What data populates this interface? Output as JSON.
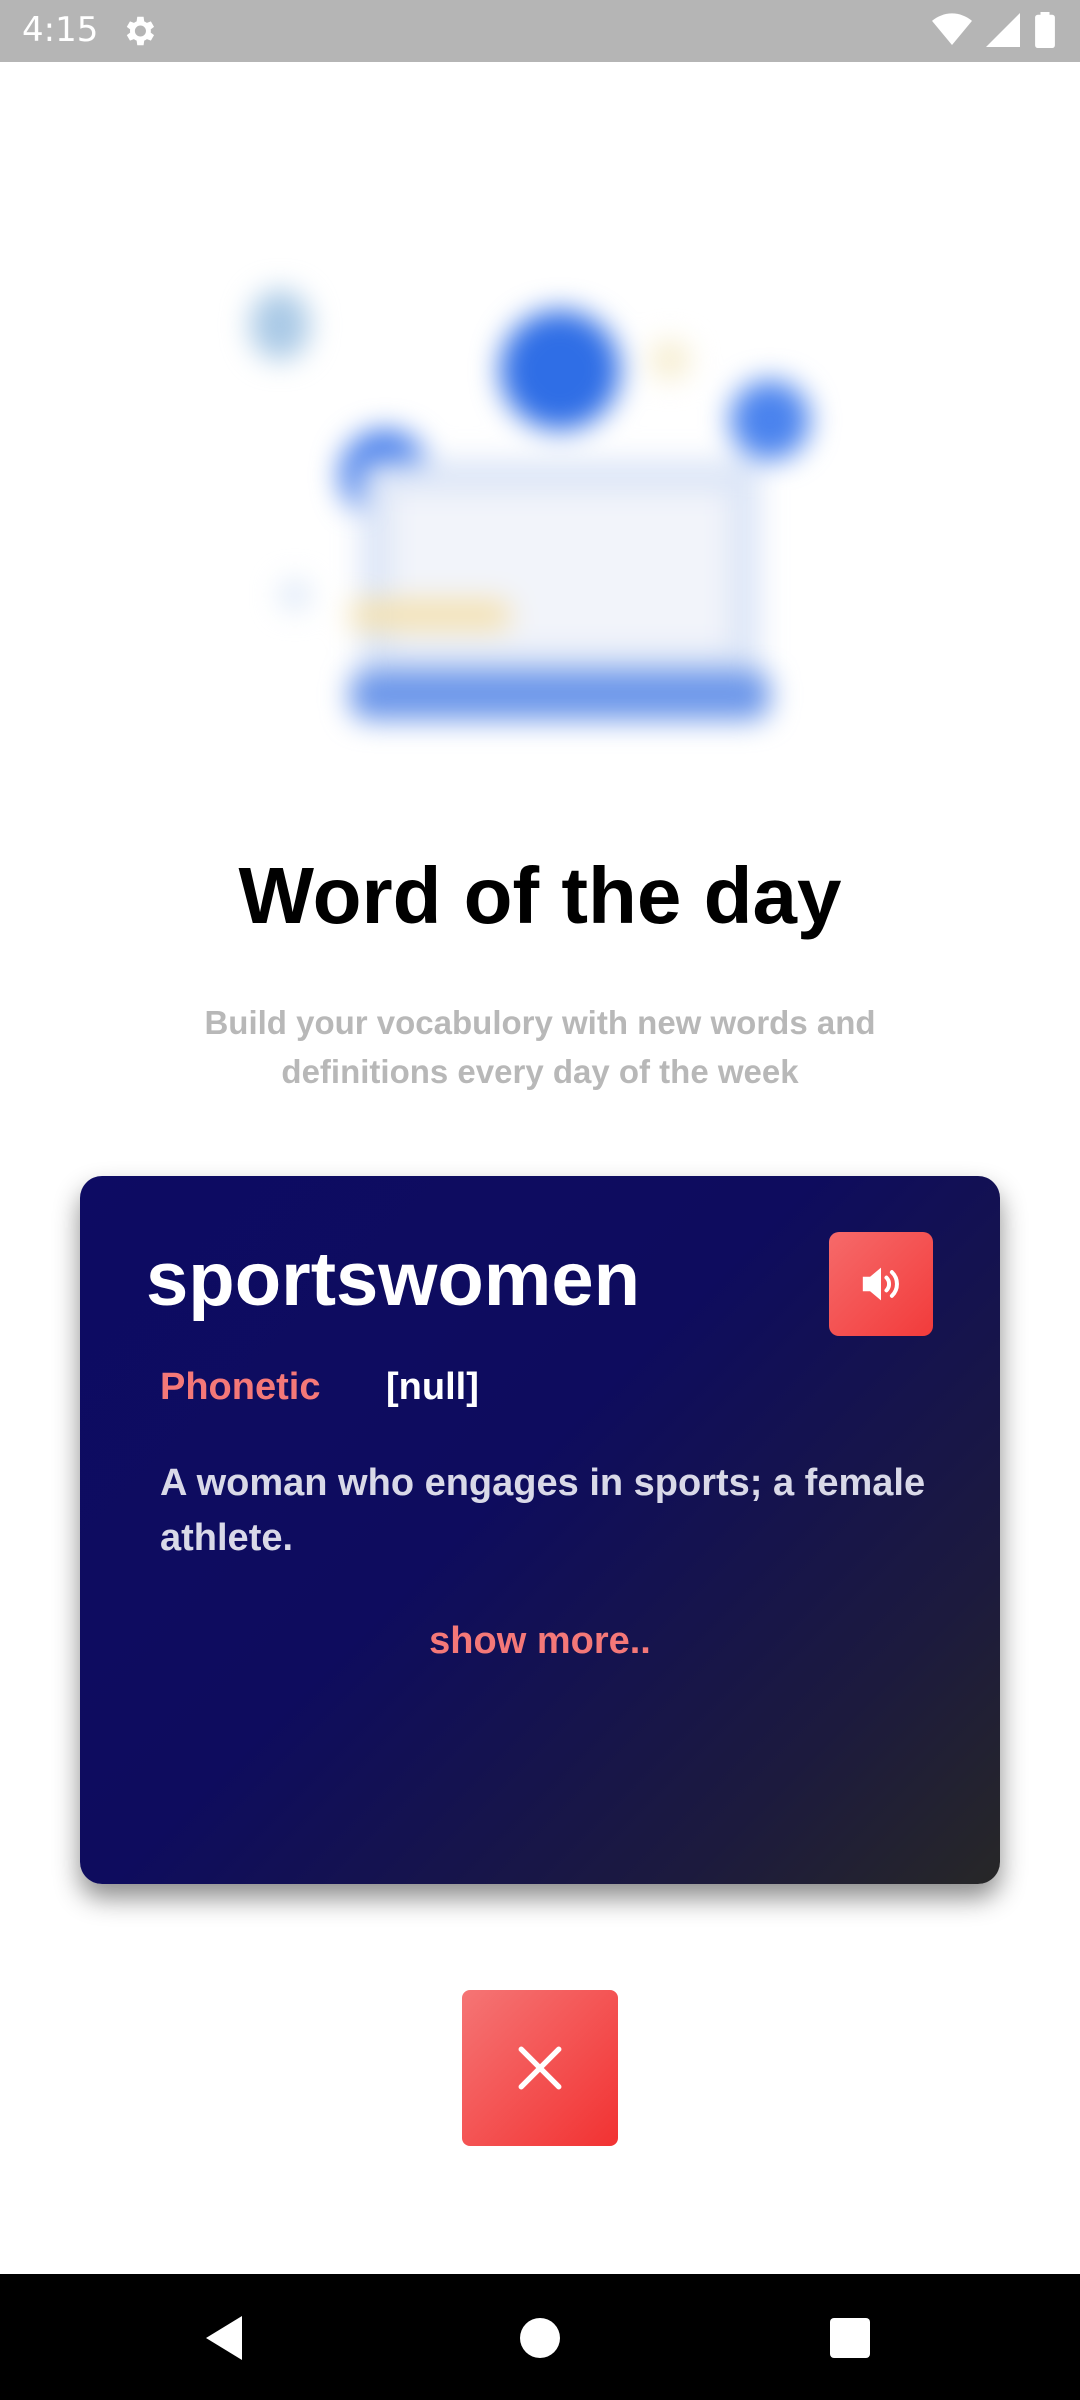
{
  "status_bar": {
    "time": "4:15",
    "icons": [
      "gear-icon",
      "wifi-icon",
      "signal-icon",
      "battery-icon"
    ]
  },
  "onboarding": {
    "title": "Word of the day",
    "subtitle": "Build your vocabulory with new words and definitions every day of the week"
  },
  "card": {
    "word": "sportswomen",
    "phonetic_label": "Phonetic",
    "phonetic_value": "[null]",
    "definition": "A woman who engages in sports; a female athlete.",
    "show_more": "show more..",
    "speaker_icon": "speaker-icon"
  },
  "close_icon": "close-icon",
  "nav_bar": {
    "icons": [
      "back-icon",
      "home-icon",
      "recents-icon"
    ]
  },
  "colors": {
    "card_start": "#0d0b63",
    "card_end": "#272727",
    "accent_red": "#f23b3b",
    "accent_text": "#f47878",
    "status_bar": "#b5b5b5"
  }
}
